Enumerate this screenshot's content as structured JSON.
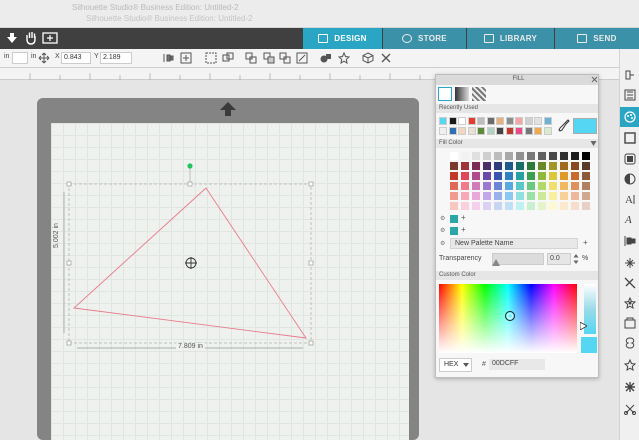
{
  "titlebar": {
    "line1": "Silhouette Studio® Business Edition: Untitled-2",
    "line2": "Silhouette Studio® Business Edition: Untitled-2"
  },
  "nav": {
    "tabs": [
      {
        "label": "DESIGN",
        "icon": "grid-icon",
        "active": true
      },
      {
        "label": "STORE",
        "icon": "store-icon",
        "active": false
      },
      {
        "label": "LIBRARY",
        "icon": "library-icon",
        "active": false
      },
      {
        "label": "SEND",
        "icon": "send-icon",
        "active": false
      }
    ]
  },
  "toolbar": {
    "unit": "in",
    "unit2": "in",
    "x_label": "X",
    "x_value": "0.843",
    "y_label": "Y",
    "y_value": "2.189"
  },
  "canvas": {
    "height_label": "5.002 in",
    "width_label": "7.809 in",
    "line_color": "#e87a8a"
  },
  "fill_panel": {
    "title": "FILL",
    "recently_used_label": "Recently Used",
    "fill_color_label": "Fill Color",
    "palette_name_placeholder": "New Palette Name",
    "transparency_label": "Transparency",
    "transparency_value": "0.0",
    "transparency_unit": "%",
    "custom_color_label": "Custom Color",
    "mode": "HEX",
    "hex_prefix": "#",
    "hex_value": "00DCFF",
    "current_color": "#55d6f2",
    "recent_colors": [
      "#55d6f2",
      "#1a1a1a",
      "#ffffff",
      "#e63b2e",
      "#bdbdbd",
      "#6b6b6b",
      "#e8b07a",
      "#8d8d8d",
      "#f4a6a6",
      "#d0d0d0",
      "#e2e2e2",
      "#6cb2d6",
      "#f0f0f0",
      "#2e6fb0",
      "#f0d8c0",
      "#ece0d2",
      "#5a8a3a",
      "#b4d0c0",
      "#444444",
      "#c0392b",
      "#e84a8a",
      "#777777",
      "#f3a94a",
      "#d8ead0"
    ],
    "swatch_rows": [
      [
        "#ffffff",
        "#f2f2f2",
        "#e0e0e0",
        "#cfcfcf",
        "#bcbcbc",
        "#a8a8a8",
        "#909090",
        "#787878",
        "#606060",
        "#484848",
        "#303030",
        "#1a1a1a",
        "#000000"
      ],
      [
        "#7a3b2e",
        "#a0343a",
        "#7a2a55",
        "#4a2e6a",
        "#2e3e7a",
        "#1f5a8a",
        "#1a6e6a",
        "#2c7a3a",
        "#6a8a2a",
        "#a0962a",
        "#a06a1f",
        "#8a4a1f",
        "#5a3a2a"
      ],
      [
        "#c0392b",
        "#e0455a",
        "#b04a8a",
        "#6a4aa8",
        "#3a55b0",
        "#2e80c0",
        "#26a0a0",
        "#3aa050",
        "#90b83a",
        "#d8c83a",
        "#e09a2a",
        "#c86a2a",
        "#8a5a3a"
      ],
      [
        "#e06a5a",
        "#f07a8a",
        "#d07ab8",
        "#9a7ad0",
        "#6a85d8",
        "#5aa8e0",
        "#5ac8c8",
        "#6ac880",
        "#b0d86a",
        "#f0e070",
        "#f0b860",
        "#e0905a",
        "#b08060"
      ],
      [
        "#f09a90",
        "#f8a8b8",
        "#e8a8d8",
        "#c0a8e8",
        "#9ab0e8",
        "#8ac8f0",
        "#90e0e0",
        "#9ae0a8",
        "#cce89a",
        "#f8f0a0",
        "#f8d09a",
        "#f0b89a",
        "#d0a890"
      ],
      [
        "#f8c8c0",
        "#fcd0da",
        "#f4d0ec",
        "#dcd0f4",
        "#c8d4f4",
        "#c0e0f8",
        "#c0f0f0",
        "#c8f0d0",
        "#e4f4c8",
        "#fcf8d0",
        "#fce8cc",
        "#f8dccc",
        "#e8d0c4"
      ]
    ],
    "palette_swatches": [
      "#2aa6a6",
      "#2aa6a6"
    ]
  },
  "rail": {
    "icons": [
      "send-panel-icon",
      "library-panel-icon",
      "fill-panel-icon",
      "line-panel-icon",
      "shadow-panel-icon",
      "contrast-icon",
      "text-icon",
      "font-icon",
      "align-icon",
      "replicate-icon",
      "transform-icon",
      "pixscan-icon",
      "design-store-icon",
      "trace-icon",
      "offset-icon",
      "star-icon",
      "puzzle-icon",
      "scissors-icon"
    ]
  }
}
